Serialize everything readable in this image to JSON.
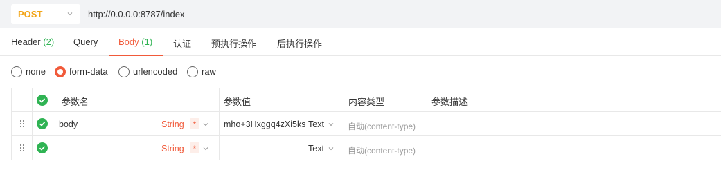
{
  "request": {
    "method": "POST",
    "url": "http://0.0.0.0:8787/index",
    "method_color": "#f2a416"
  },
  "tabs": [
    {
      "label": "Header",
      "count": "(2)"
    },
    {
      "label": "Query",
      "count": ""
    },
    {
      "label": "Body",
      "count": "(1)",
      "active": true
    },
    {
      "label": "认证",
      "count": ""
    },
    {
      "label": "预执行操作",
      "count": ""
    },
    {
      "label": "后执行操作",
      "count": ""
    }
  ],
  "body_types": [
    {
      "label": "none",
      "selected": false
    },
    {
      "label": "form-data",
      "selected": true
    },
    {
      "label": "urlencoded",
      "selected": false
    },
    {
      "label": "raw",
      "selected": false
    }
  ],
  "table": {
    "headers": {
      "name": "参数名",
      "value": "参数值",
      "content_type": "内容类型",
      "description": "参数描述"
    },
    "rows": [
      {
        "name": "body",
        "type": "String",
        "required": "*",
        "value": "mho+3Hxggq4zXi5ks",
        "value_type": "Text",
        "content_type": "自动(content-type)",
        "description": "",
        "enabled": true
      },
      {
        "name": "",
        "type": "String",
        "required": "*",
        "value": "",
        "value_type": "Text",
        "content_type": "自动(content-type)",
        "description": "",
        "enabled": true
      }
    ]
  },
  "colors": {
    "accent": "#f15a3a",
    "check_green": "#2fb353",
    "count_green": "#2fb353"
  }
}
